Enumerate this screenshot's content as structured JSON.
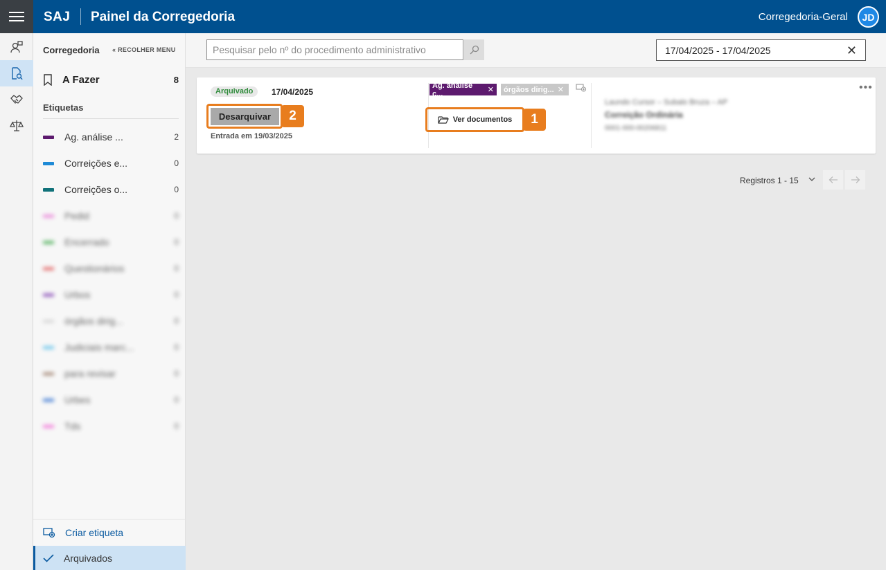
{
  "header": {
    "brand": "SAJ",
    "title": "Painel da Corregedoria",
    "user_name": "Corregedoria-Geral",
    "avatar_initials": "JD"
  },
  "rail": [
    "person-arrow-icon",
    "document-search-icon",
    "handshake-icon",
    "scales-icon"
  ],
  "sidebar": {
    "title": "Corregedoria",
    "collapse_label": "RECOLHER MENU",
    "todo_label": "A Fazer",
    "todo_count": "8",
    "tags_heading": "Etiquetas",
    "tags": [
      {
        "name": "Ag. análise ...",
        "count": "2",
        "color": "#5d1a6e"
      },
      {
        "name": "Correições e...",
        "count": "0",
        "color": "#1e8ad6"
      },
      {
        "name": "Correições o...",
        "count": "0",
        "color": "#11727a"
      },
      {
        "name": "Pedid",
        "count": "0",
        "color": "#e879d6"
      },
      {
        "name": "Encerrado",
        "count": "0",
        "color": "#3ea84a"
      },
      {
        "name": "Questionários",
        "count": "0",
        "color": "#e05656"
      },
      {
        "name": "Urbos",
        "count": "0",
        "color": "#7d3ab0"
      },
      {
        "name": "órgãos dirig...",
        "count": "0",
        "color": "#d0d0d0"
      },
      {
        "name": "Judiciais marc...",
        "count": "0",
        "color": "#5cc0ea"
      },
      {
        "name": "para revisar",
        "count": "0",
        "color": "#9a7a66"
      },
      {
        "name": "Urbes",
        "count": "0",
        "color": "#2e6fd0"
      },
      {
        "name": "Tds",
        "count": "0",
        "color": "#f26bd6"
      }
    ],
    "create_tag_label": "Criar etiqueta",
    "archived_label": "Arquivados"
  },
  "search": {
    "placeholder": "Pesquisar pelo nº do procedimento administrativo",
    "value": ""
  },
  "date_filter": {
    "value": "17/04/2025 - 17/04/2025",
    "clear": "✕"
  },
  "card": {
    "status": "Arquivado",
    "date": "17/04/2025",
    "unarchive_label": "Desarquivar",
    "entry_text": "Entrada em 19/03/2025",
    "chips": [
      "Ag. análise c...",
      "órgãos dirig..."
    ],
    "view_docs_label": "Ver documentos",
    "info_line1": "Laundo Cursor – Subalo Bruza – AP",
    "info_line2": "Correição Ordinária",
    "info_line3": "0001-000-00206811",
    "more_label": "•••"
  },
  "badges": {
    "one": "1",
    "two": "2"
  },
  "pagination": {
    "records_label": "Registros 1 - 15"
  },
  "colors": {
    "header": "#00508f",
    "accent_orange": "#e87d1e",
    "status_green": "#2e8b3a"
  }
}
